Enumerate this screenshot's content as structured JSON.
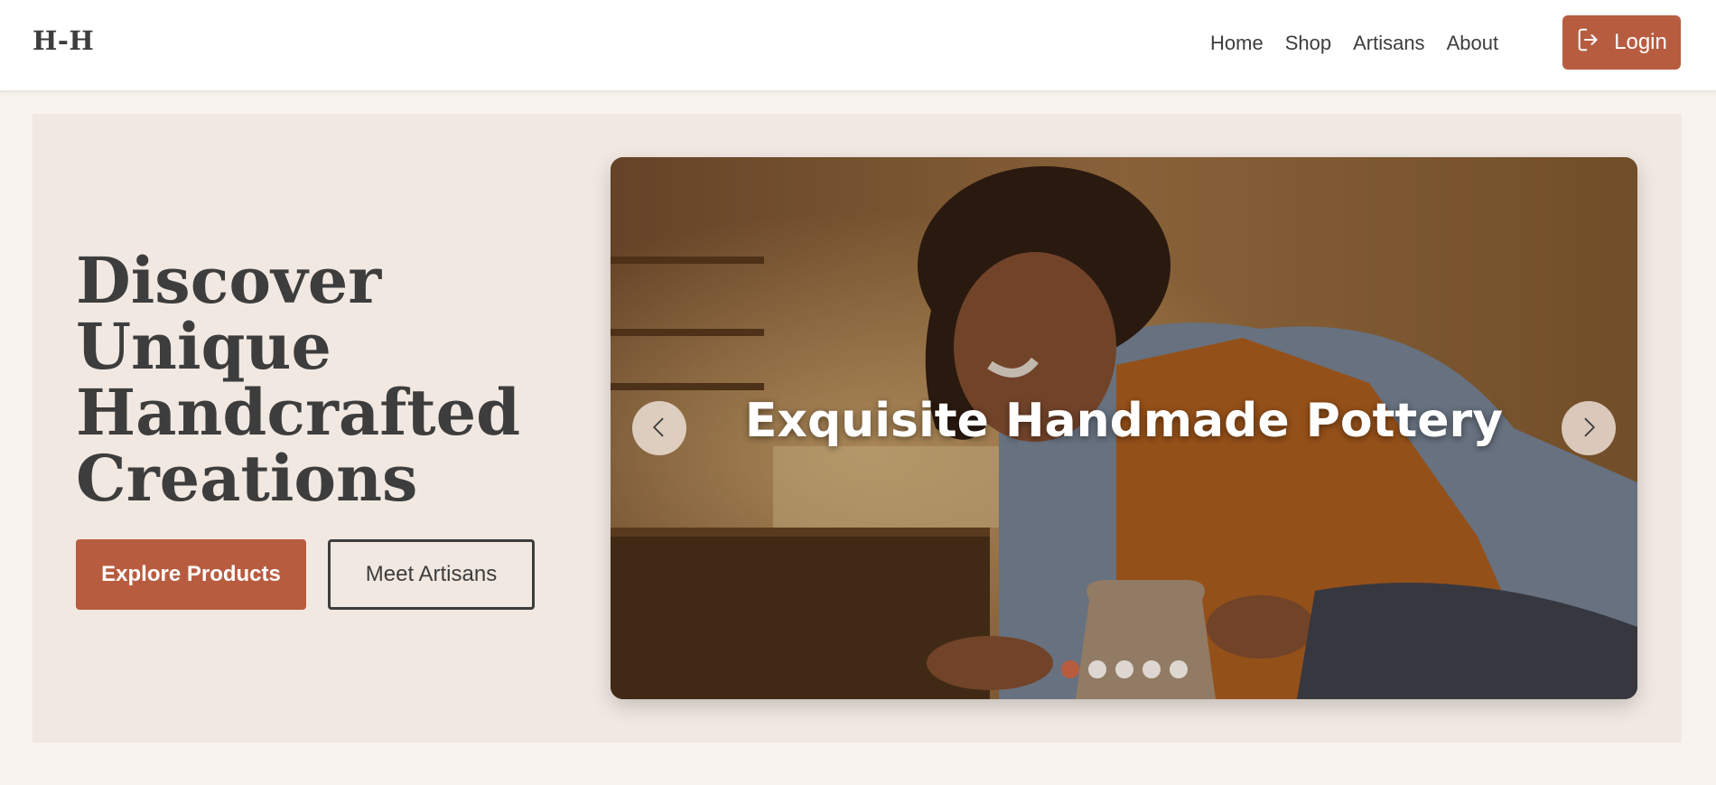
{
  "header": {
    "logo": "H-H",
    "nav": [
      {
        "label": "Home"
      },
      {
        "label": "Shop"
      },
      {
        "label": "Artisans"
      },
      {
        "label": "About"
      }
    ],
    "login_label": "Login",
    "login_icon": "sign-in-icon"
  },
  "hero": {
    "title_lines": [
      "Discover",
      "Unique",
      "Handcrafted",
      "Creations"
    ],
    "primary_button": "Explore Products",
    "secondary_button": "Meet Artisans"
  },
  "carousel": {
    "caption": "Exquisite Handmade Pottery",
    "prev_icon": "chevron-left-icon",
    "next_icon": "chevron-right-icon",
    "slide_count": 5,
    "active_index": 0
  },
  "colors": {
    "accent": "#b85c40",
    "text": "#3d3d3d",
    "page_bg": "#f7f2ed",
    "hero_bg": "#f1e8e1"
  }
}
